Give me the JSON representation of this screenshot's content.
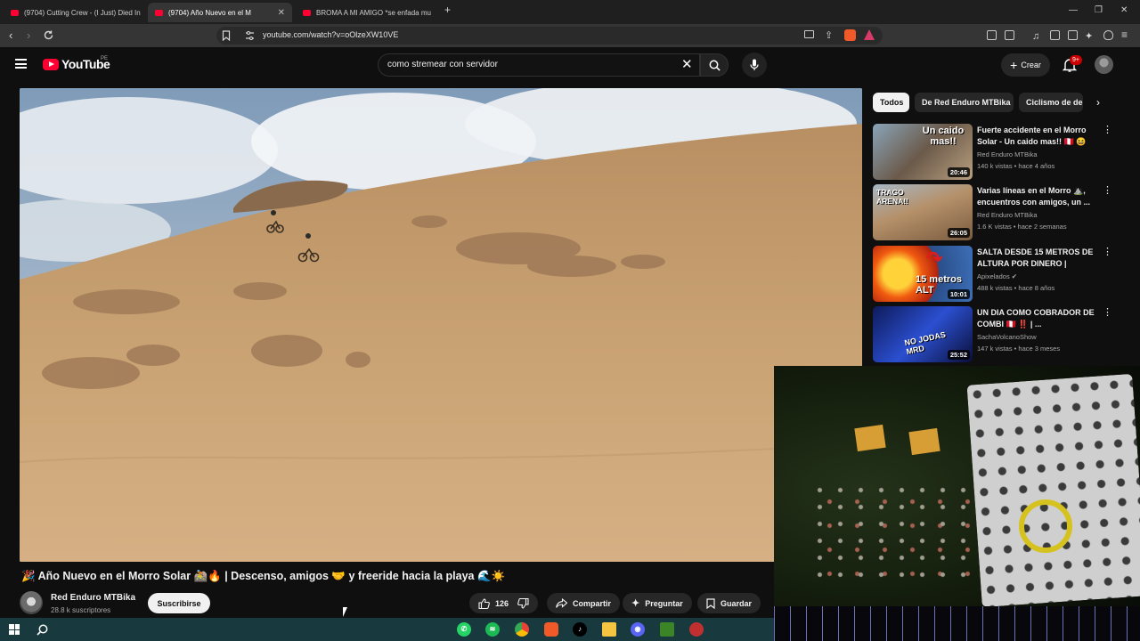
{
  "browser": {
    "tabs": [
      {
        "title": "(9704) Cutting Crew - (I Just) Died In",
        "active": false
      },
      {
        "title": "(9704)  Año Nuevo en el M",
        "active": true
      },
      {
        "title": "BROMA A MI AMIGO *se enfada mu",
        "active": false
      }
    ],
    "new_tab": "+",
    "url": "youtube.com/watch?v=oOlzeXW10VE",
    "window_controls": [
      "—",
      "❐",
      "✕"
    ]
  },
  "youtube": {
    "logo_text": "YouTube",
    "country_code": "PE",
    "search_value": "como stremear con servidor",
    "create_label": "Crear",
    "notifications_badge": "9+",
    "accent_color": "#ff0033"
  },
  "video": {
    "title": "🎉 Año Nuevo en el Morro Solar 🚵🔥 | Descenso, amigos 🤝 y freeride hacia la playa 🌊☀️",
    "channel_name": "Red Enduro MTBika",
    "channel_subs": "28.8 k suscriptores",
    "subscribe_label": "Suscribirse",
    "likes": "126",
    "share_label": "Compartir",
    "ask_label": "Preguntar",
    "save_label": "Guardar"
  },
  "sidebar": {
    "chips": [
      "Todos",
      "De Red Enduro MTBika",
      "Ciclismo de de"
    ],
    "chip_next": "›",
    "recommendations": [
      {
        "title": "Fuerte accidente en el Morro Solar - Un caido mas!! 🇵🇪 😆",
        "channel": "Red Enduro MTBika",
        "meta": "140 k vistas • hace 4 años",
        "duration": "20:46",
        "thumb_text": "Un caido mas!!"
      },
      {
        "title": "Varias líneas en el Morro ⛰️, encuentros con amigos, un ...",
        "channel": "Red Enduro MTBika",
        "meta": "1.6 K vistas • hace 2 semanas",
        "duration": "26:05",
        "thumb_text": "TRAGO ARENA!!"
      },
      {
        "title": "SALTA DESDE 15 METROS DE ALTURA POR DINERO | PODRÍ...",
        "channel": "Apixelados ✔",
        "meta": "488 k vistas • hace 8 años",
        "duration": "10:01",
        "thumb_text": "15 metros ALT"
      },
      {
        "title": "UN DIA COMO COBRADOR DE COMBI 🇵🇪 ‼️ | ...",
        "channel": "SachaVolcanoShow",
        "meta": "147 k vistas • hace 3 meses",
        "duration": "25:52",
        "thumb_text": "NO JODAS MRD"
      }
    ]
  },
  "taskbar": {
    "apps": [
      "start-button",
      "search",
      "whatsapp",
      "spotify",
      "chrome",
      "brave",
      "tiktok",
      "files",
      "discord",
      "minecraft",
      "app"
    ]
  }
}
